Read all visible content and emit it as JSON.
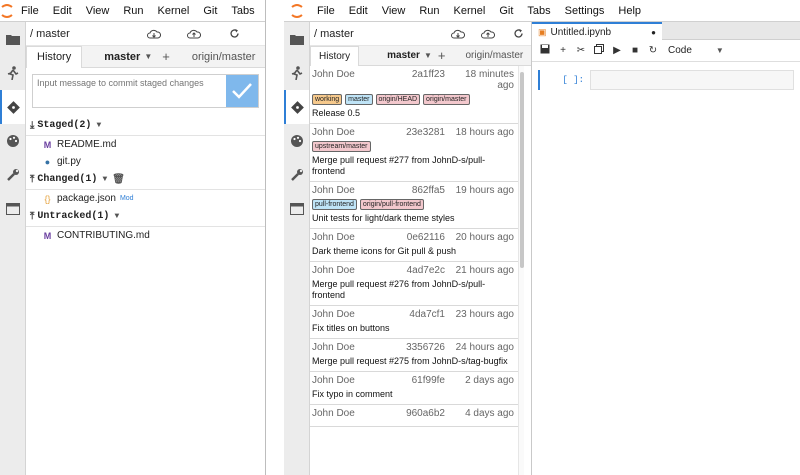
{
  "pane_a": {
    "menu": [
      "File",
      "Edit",
      "View",
      "Run",
      "Kernel",
      "Git",
      "Tabs",
      "Se"
    ],
    "path": "/ master",
    "tabs": {
      "history": "History",
      "branch": "master",
      "remote": "origin/master"
    },
    "commit_input": {
      "placeholder": "Input message to commit staged changes"
    },
    "staged": {
      "title": "Staged(2)",
      "files": [
        "README.md",
        "git.py"
      ]
    },
    "changed": {
      "title": "Changed(1)",
      "files": [
        {
          "name": "package.json",
          "status": "Mod"
        }
      ]
    },
    "untracked": {
      "title": "Untracked(1)",
      "files": [
        "CONTRIBUTING.md"
      ]
    }
  },
  "pane_b": {
    "menu": [
      "File",
      "Edit",
      "View",
      "Run",
      "Kernel",
      "Git",
      "Tabs",
      "Settings",
      "Help"
    ],
    "path": "/ master",
    "tabs": {
      "history": "History",
      "branch": "master",
      "remote": "origin/master"
    },
    "commits": [
      {
        "author": "John Doe",
        "sha": "2a1ff23",
        "time": "18 minutes ago",
        "tags": [
          {
            "label": "working",
            "kind": "working"
          },
          {
            "label": "master",
            "kind": "local"
          },
          {
            "label": "origin/HEAD",
            "kind": "remote"
          },
          {
            "label": "origin/master",
            "kind": "remote"
          }
        ],
        "message": "Release 0.5"
      },
      {
        "author": "John Doe",
        "sha": "23e3281",
        "time": "18 hours ago",
        "tags": [
          {
            "label": "upstream/master",
            "kind": "remote"
          }
        ],
        "message": "Merge pull request #277 from  JohnD-s/pull-frontend"
      },
      {
        "author": "John Doe",
        "sha": "862ffa5",
        "time": "19 hours ago",
        "tags": [
          {
            "label": "pull-frontend",
            "kind": "local"
          },
          {
            "label": "origin/pull-frontend",
            "kind": "remote"
          }
        ],
        "message": "Unit tests for light/dark theme styles"
      },
      {
        "author": "John Doe",
        "sha": "0e62116",
        "time": "20 hours ago",
        "tags": [],
        "message": "Dark theme icons for Git pull & push"
      },
      {
        "author": "John Doe",
        "sha": "4ad7e2c",
        "time": "21 hours ago",
        "tags": [],
        "message": "Merge pull request #276 from  JohnD-s/pull-frontend"
      },
      {
        "author": "John Doe",
        "sha": "4da7cf1",
        "time": "23 hours ago",
        "tags": [],
        "message": "Fix titles on buttons"
      },
      {
        "author": "John Doe",
        "sha": "3356726",
        "time": "24 hours ago",
        "tags": [],
        "message": "Merge pull request #275 from  JohnD-s/tag-bugfix"
      },
      {
        "author": "John Doe",
        "sha": "61f99fe",
        "time": "2 days ago",
        "tags": [],
        "message": "Fix typo in comment"
      },
      {
        "author": "John Doe",
        "sha": "960a6b2",
        "time": "4 days ago",
        "tags": [],
        "message": ""
      }
    ],
    "notebook": {
      "tab_title": "Untitled.ipynb",
      "cell_type": "Code",
      "prompt": "[ ]:"
    }
  }
}
